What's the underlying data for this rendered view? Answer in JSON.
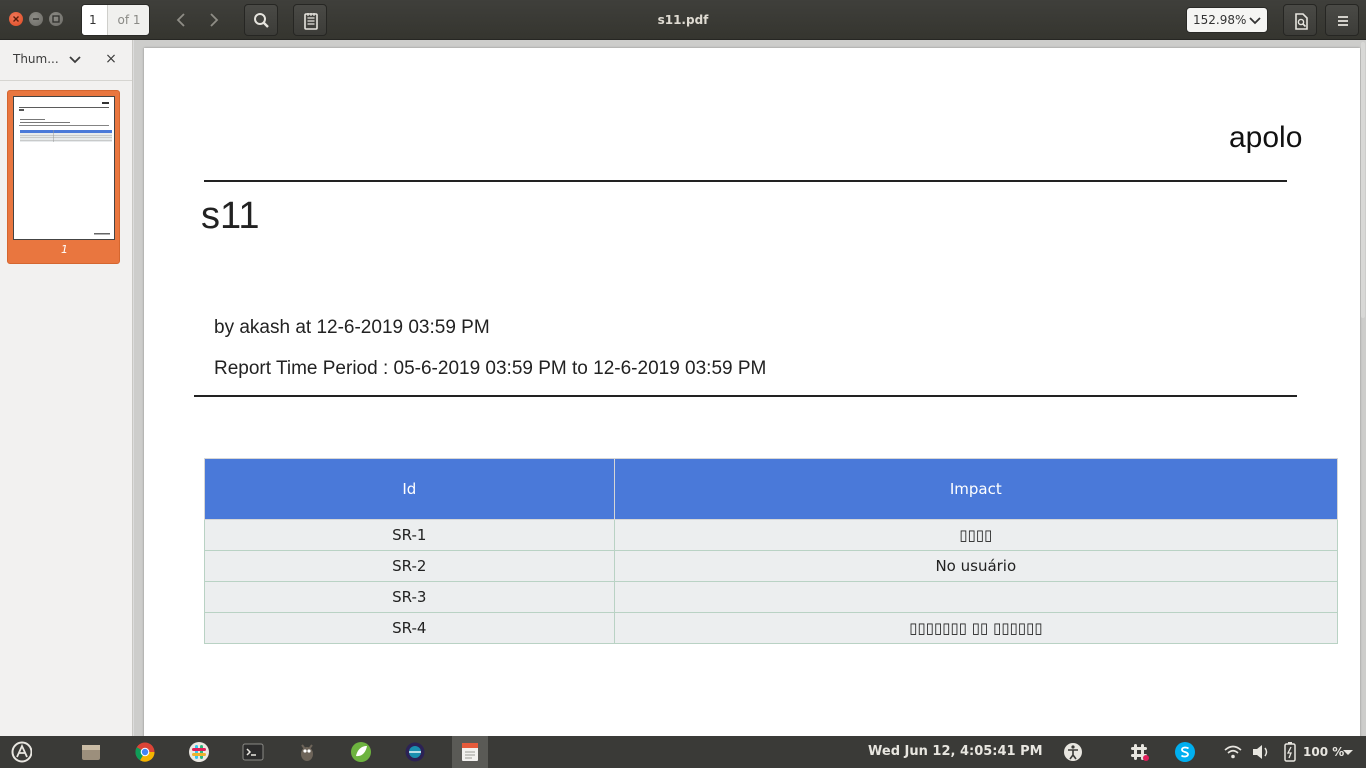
{
  "toolbar": {
    "page_number": "1",
    "page_total": "of 1",
    "document_title": "s11.pdf",
    "zoom": "152.98%"
  },
  "sidebar": {
    "mode_label": "Thum...",
    "close_label": "×",
    "thumbnail_label": "1"
  },
  "report": {
    "company": "apolo",
    "title": "s11",
    "byline": "by akash at 12-6-2019 03:59 PM",
    "period": "Report Time Period : 05-6-2019 03:59 PM to 12-6-2019 03:59 PM",
    "table": {
      "headers": [
        "Id",
        "Impact"
      ],
      "rows": [
        [
          "SR-1",
          "▯▯▯▯"
        ],
        [
          "SR-2",
          "No usuário"
        ],
        [
          "SR-3",
          ""
        ],
        [
          "SR-4",
          "▯▯▯▯▯▯▯ ▯▯ ▯▯▯▯▯▯"
        ]
      ]
    }
  },
  "taskbar": {
    "clock": "Wed Jun 12,  4:05:41 PM",
    "battery": "100 %"
  },
  "colors": {
    "toolbar_bg": "#3c3c38",
    "thumbnail_accent": "#e9763f",
    "table_header": "#4a79d9",
    "close_button": "#e4572e"
  },
  "icons": [
    "close-icon",
    "minimize-icon",
    "maximize-icon",
    "chevron-left-icon",
    "chevron-right-icon",
    "search-icon",
    "annotations-icon",
    "chevron-down-icon",
    "document-properties-icon",
    "hamburger-menu-icon",
    "ubuntu-logo-icon",
    "files-icon",
    "chrome-icon",
    "slack-icon",
    "terminal-icon",
    "gimp-icon",
    "spring-icon",
    "eclipse-icon",
    "document-viewer-icon",
    "accessibility-icon",
    "skype-icon",
    "wifi-icon",
    "volume-icon",
    "battery-icon"
  ]
}
